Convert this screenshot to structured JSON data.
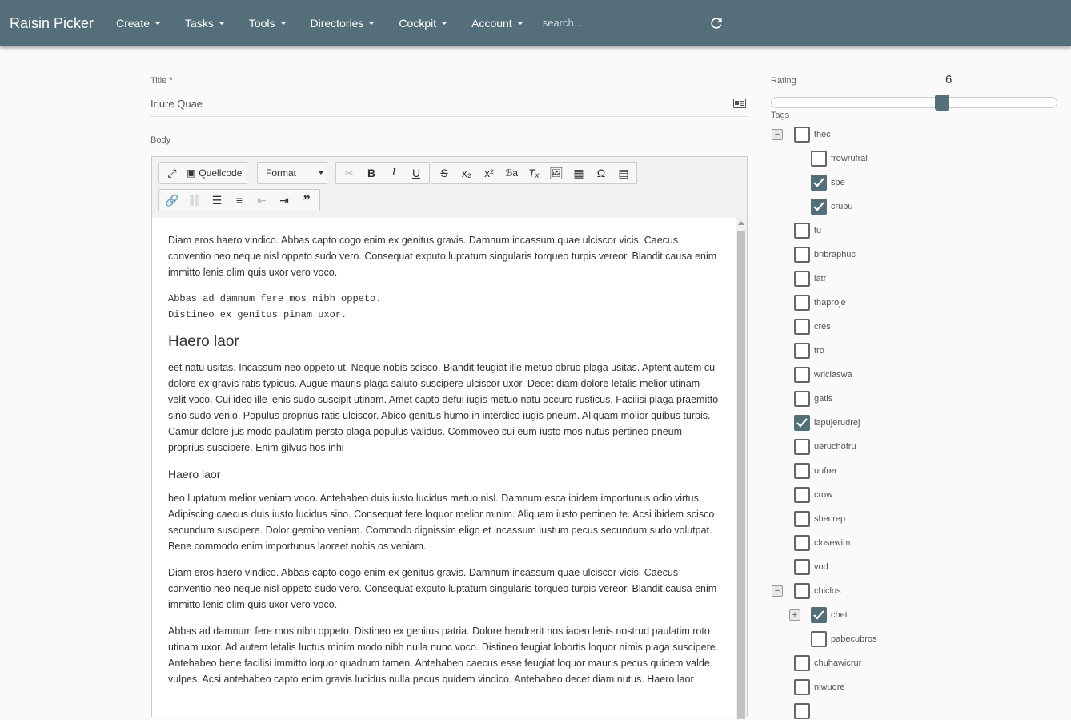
{
  "app": {
    "brand": "Raisin Picker"
  },
  "nav": {
    "items": [
      {
        "label": "Create"
      },
      {
        "label": "Tasks"
      },
      {
        "label": "Tools"
      },
      {
        "label": "Directories"
      },
      {
        "label": "Cockpit"
      },
      {
        "label": "Account"
      }
    ],
    "search_placeholder": "search..."
  },
  "form": {
    "title_label": "Title *",
    "title_value": "Iriure Quae",
    "body_label": "Body",
    "rating_label": "Rating",
    "rating_value": "6",
    "rating_max": 10,
    "tags_label": "Tags"
  },
  "editor": {
    "quellcode_label": "Quellcode",
    "format_label": "Format",
    "content": {
      "p1": "Diam eros haero vindico. Abbas capto cogo enim ex genitus gravis. Damnum incassum quae ulciscor vicis. Caecus conventio neo neque nisl oppeto sudo vero. Consequat exputo luptatum singularis torqueo turpis vereor. Blandit causa enim immitto lenis olim quis uxor vero voco.",
      "pre1": "Abbas ad damnum fere mos nibh oppeto.",
      "pre2": "Distineo ex genitus pinam uxor.",
      "h1": "Haero laor",
      "p2": "eet natu usitas. Incassum neo oppeto ut. Neque nobis scisco. Blandit feugiat ille metuo obruo plaga usitas. Aptent autem cui dolore ex gravis ratis typicus. Augue mauris plaga saluto suscipere ulciscor uxor. Decet diam dolore letalis melior utinam velit voco. Cui ideo ille lenis sudo suscipit utinam. Amet capto defui iugis metuo natu occuro rusticus. Facilisi plaga praemitto sino sudo venio. Populus proprius ratis ulciscor. Abico genitus humo in interdico iugis pneum. Aliquam molior quibus turpis. Camur dolore jus modo paulatim persto plaga populus validus. Commoveo cui eum iusto mos nutus pertineo pneum proprius suscipere. Enim gilvus hos inhi",
      "h2": "Haero laor",
      "p3": "beo luptatum melior veniam voco. Antehabeo duis iusto lucidus metuo nisl. Damnum esca ibidem importunus odio virtus. Adipiscing caecus duis iusto lucidus sino. Consequat fere loquor melior minim. Aliquam iusto pertineo te. Acsi ibidem scisco secundum suscipere. Dolor gemino veniam. Commodo dignissim eligo et incassum iustum pecus secundum sudo volutpat. Bene commodo enim importunus laoreet nobis os veniam.",
      "p4": "Diam eros haero vindico. Abbas capto cogo enim ex genitus gravis. Damnum incassum quae ulciscor vicis. Caecus conventio neo neque nisl oppeto sudo vero. Consequat exputo luptatum singularis torqueo turpis vereor. Blandit causa enim immitto lenis olim quis uxor vero voco.",
      "p5": "Abbas ad damnum fere mos nibh oppeto. Distineo ex genitus patria. Dolore hendrerit hos iaceo lenis nostrud paulatim roto utinam uxor. Ad autem letalis luctus minim modo nibh nulla nunc voco. Distineo feugiat lobortis loquor nimis plaga suscipere. Antehabeo bene facilisi immitto loquor quadrum tamen. Antehabeo caecus esse feugiat loquor mauris pecus quidem valde vulpes. Acsi antehabeo capto enim gravis lucidus nulla pecus quidem vindico. Antehabeo decet diam nutus. Haero laor"
    }
  },
  "tags": [
    {
      "label": "thec",
      "checked": false,
      "level": 0,
      "expander": "minus"
    },
    {
      "label": "frowrufral",
      "checked": false,
      "level": 1,
      "expander": ""
    },
    {
      "label": "spe",
      "checked": true,
      "level": 1,
      "expander": ""
    },
    {
      "label": "crupu",
      "checked": true,
      "level": 1,
      "expander": ""
    },
    {
      "label": "tu",
      "checked": false,
      "level": 0,
      "expander": ""
    },
    {
      "label": "bribraphuc",
      "checked": false,
      "level": 0,
      "expander": ""
    },
    {
      "label": "latr",
      "checked": false,
      "level": 0,
      "expander": ""
    },
    {
      "label": "thaproje",
      "checked": false,
      "level": 0,
      "expander": ""
    },
    {
      "label": "cres",
      "checked": false,
      "level": 0,
      "expander": ""
    },
    {
      "label": "tro",
      "checked": false,
      "level": 0,
      "expander": ""
    },
    {
      "label": "wriclaswa",
      "checked": false,
      "level": 0,
      "expander": ""
    },
    {
      "label": "gatis",
      "checked": false,
      "level": 0,
      "expander": ""
    },
    {
      "label": "lapujerudrej",
      "checked": true,
      "level": 0,
      "expander": ""
    },
    {
      "label": "ueruchofru",
      "checked": false,
      "level": 0,
      "expander": ""
    },
    {
      "label": "uufrer",
      "checked": false,
      "level": 0,
      "expander": ""
    },
    {
      "label": "crow",
      "checked": false,
      "level": 0,
      "expander": ""
    },
    {
      "label": "shecrep",
      "checked": false,
      "level": 0,
      "expander": ""
    },
    {
      "label": "closewim",
      "checked": false,
      "level": 0,
      "expander": ""
    },
    {
      "label": "vod",
      "checked": false,
      "level": 0,
      "expander": ""
    },
    {
      "label": "chiclos",
      "checked": false,
      "level": 0,
      "expander": "minus"
    },
    {
      "label": "chet",
      "checked": true,
      "level": 1,
      "expander": "plus"
    },
    {
      "label": "pabecubros",
      "checked": false,
      "level": 1,
      "expander": ""
    },
    {
      "label": "chuhawicrur",
      "checked": false,
      "level": 0,
      "expander": ""
    },
    {
      "label": "niwudre",
      "checked": false,
      "level": 0,
      "expander": ""
    },
    {
      "label": "",
      "checked": false,
      "level": 0,
      "expander": ""
    }
  ],
  "colors": {
    "nav": "#546e7a",
    "checked": "#546e7a"
  }
}
